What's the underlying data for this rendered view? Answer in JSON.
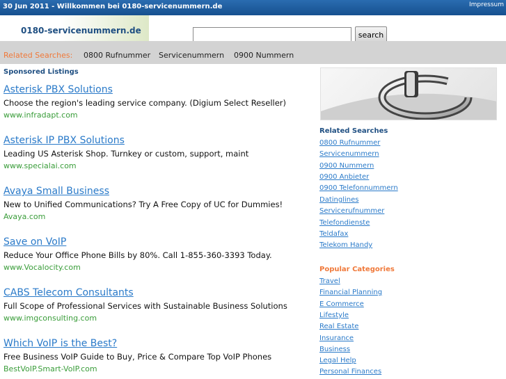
{
  "topbar": {
    "date_text": "30 Jun 2011 - Willkommen bei 0180-servicenummern.de",
    "impressum_label": "Impressum"
  },
  "header": {
    "site_name": "0180-servicenummern.de",
    "search_value": "",
    "search_button_label": "search"
  },
  "related_bar": {
    "label": "Related Searches:",
    "links": [
      "0800 Rufnummer",
      "Servicenummern",
      "0900 Nummern"
    ]
  },
  "sponsored_label": "Sponsored Listings",
  "ads": [
    {
      "title": "Asterisk PBX Solutions",
      "desc": "Choose the region's leading service company. (Digium Select Reseller)",
      "url": "www.infradapt.com"
    },
    {
      "title": "Asterisk IP PBX Solutions",
      "desc": "Leading US Asterisk Shop. Turnkey or custom, support, maint",
      "url": "www.specialai.com"
    },
    {
      "title": "Avaya Small Business",
      "desc": "New to Unified Communications? Try A Free Copy of UC for Dummies!",
      "url": "Avaya.com"
    },
    {
      "title": "Save on VoIP",
      "desc": "Reduce Your Office Phone Bills by 80%. Call 1-855-360-3393 Today.",
      "url": "www.Vocalocity.com"
    },
    {
      "title": "CABS Telecom Consultants",
      "desc": "Full Scope of Professional Services with Sustainable Business Solutions",
      "url": "www.imgconsulting.com"
    },
    {
      "title": "Which VoIP is the Best?",
      "desc": "Free Business VoIP Guide to Buy, Price & Compare Top VoIP Phones",
      "url": "BestVoIP.Smart-VoIP.com"
    }
  ],
  "sidebar": {
    "related_heading": "Related Searches",
    "related_links": [
      "0800 Rufnummer",
      "Servicenummern",
      "0900 Nummern",
      "0900 Anbieter",
      "0900 Telefonnummern",
      "Datinglines",
      "Servicerufnummer",
      "Telefondienste",
      "Teldafax",
      "Telekom Handy"
    ],
    "popular_heading": "Popular Categories",
    "popular_links": [
      "Travel",
      "Financial Planning",
      "E Commerce",
      "Lifestyle",
      "Real Estate",
      "Insurance",
      "Business",
      "Legal Help",
      "Personal Finances"
    ]
  },
  "colors": {
    "topbar": "#1e5c9e",
    "link_blue": "#2a7ac9",
    "url_green": "#3a9d3a",
    "accent_orange": "#f0793a",
    "related_bar_bg": "#d3d3d3",
    "heading_navy": "#1f4f82"
  }
}
